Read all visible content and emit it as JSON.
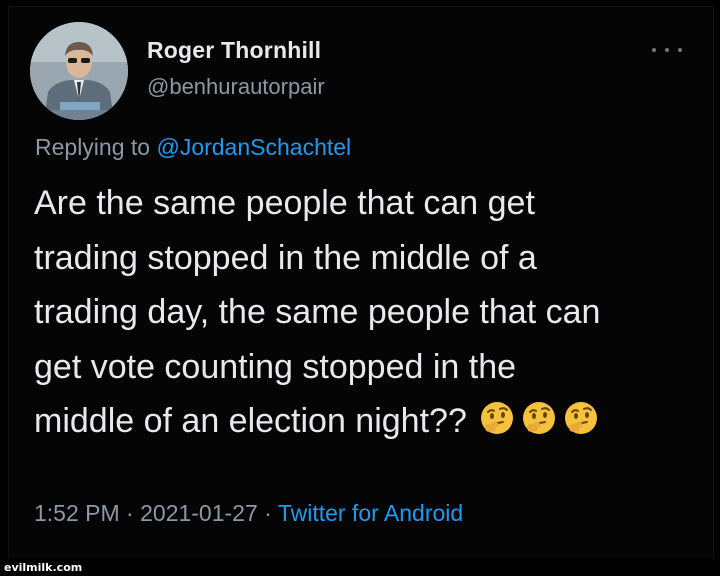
{
  "tweet": {
    "display_name": "Roger Thornhill",
    "handle": "@benhurautorpair",
    "replying_prefix": "Replying to",
    "replying_to": "@JordanSchachtel",
    "text_lines": [
      "Are the same people that can get",
      "trading stopped in the middle of a",
      "trading day, the same people that can",
      "get vote counting stopped in the",
      "middle of an election night??"
    ],
    "emojis": [
      "thinking-face",
      "thinking-face",
      "thinking-face"
    ],
    "time": "1:52 PM",
    "separator": "·",
    "date": "2021-01-27",
    "source": "Twitter for Android"
  },
  "watermark": "evilmilk.com",
  "colors": {
    "background": "#000000",
    "primary_text": "#e7e9ea",
    "secondary_text": "#8b98a5",
    "link": "#1d9bf0"
  }
}
